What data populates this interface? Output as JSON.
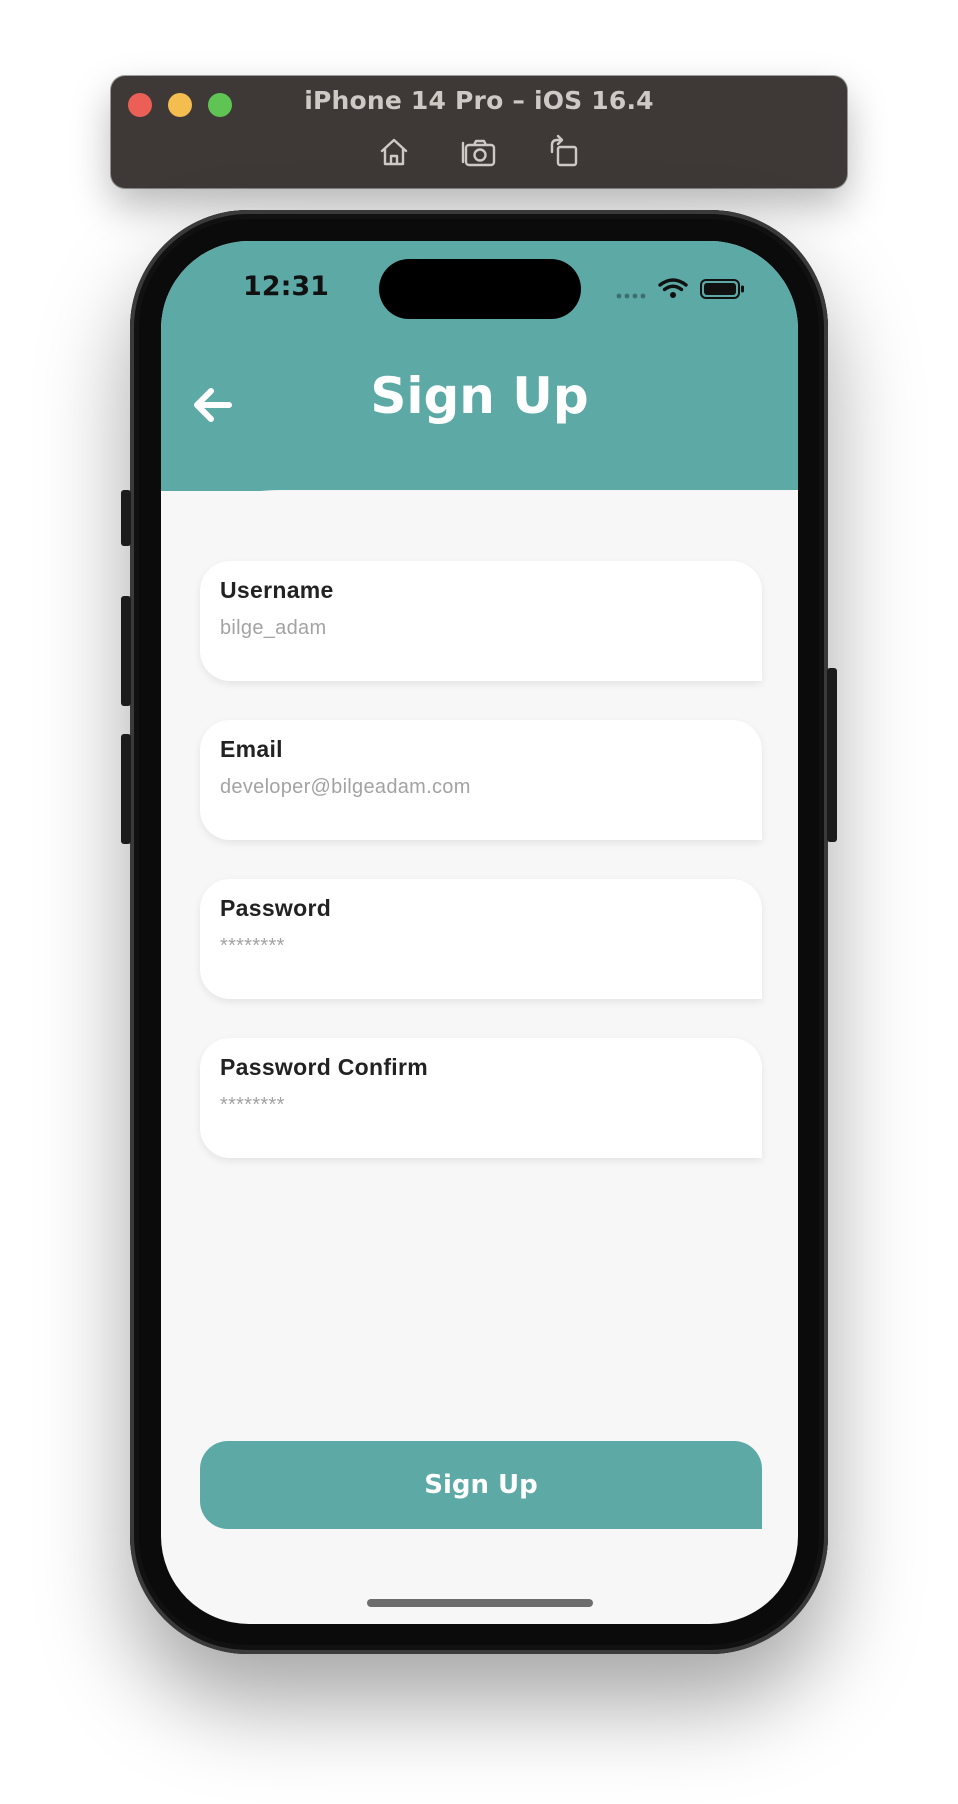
{
  "simulator": {
    "title": "iPhone 14 Pro – iOS 16.4",
    "tools": [
      "home-icon",
      "screenshot-icon",
      "rotate-icon"
    ]
  },
  "status_bar": {
    "time": "12:31"
  },
  "header": {
    "title": "Sign Up",
    "back_icon": "arrow-left-icon"
  },
  "form": {
    "fields": [
      {
        "label": "Username",
        "placeholder": "bilge_adam",
        "type": "text"
      },
      {
        "label": "Email",
        "placeholder": "developer@bilgeadam.com",
        "type": "email"
      },
      {
        "label": "Password",
        "placeholder": "********",
        "type": "password"
      },
      {
        "label": "Password Confirm",
        "placeholder": "********",
        "type": "password"
      }
    ],
    "submit_label": "Sign Up"
  },
  "colors": {
    "accent": "#5ca9a6",
    "background": "#f7f7f7",
    "field": "#ffffff",
    "placeholder": "#a3a3a3"
  }
}
